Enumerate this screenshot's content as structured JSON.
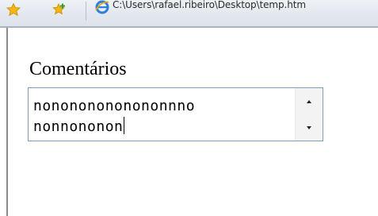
{
  "browser": {
    "tab_title": "C:\\Users\\rafael.ribeiro\\Desktop\\temp.htm",
    "toolbar_icons": [
      "favorites-star-icon",
      "add-to-favorites-icon"
    ],
    "tab_icon": "internet-explorer-icon"
  },
  "form": {
    "label": "Comentários",
    "textarea_line1": "nonononononononnno",
    "textarea_line2": "nonnononon"
  },
  "colors": {
    "textarea_border": "#7f9db9",
    "toolbar_bg": "#e3e8ef"
  }
}
